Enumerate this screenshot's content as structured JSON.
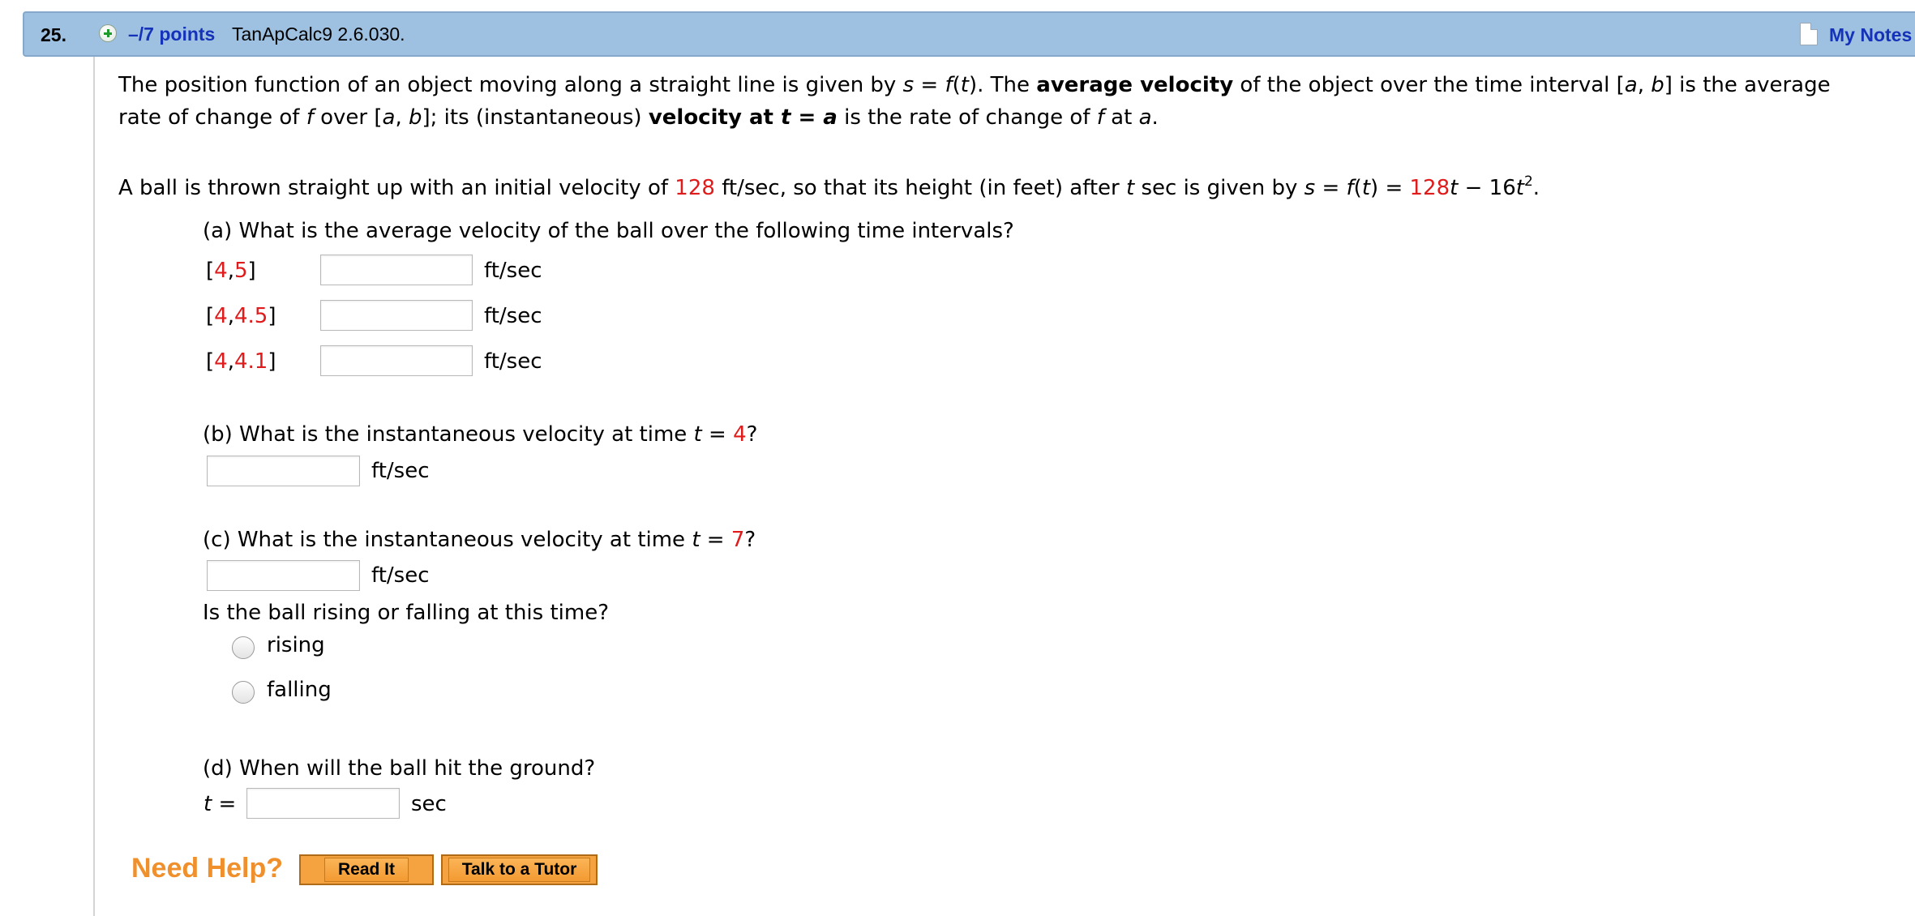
{
  "header": {
    "question_number": "25.",
    "points": "–/7 points",
    "source": "TanApCalc9 2.6.030.",
    "my_notes": "My Notes"
  },
  "intro": {
    "p1a": "The position function of an object moving along a straight line is given by ",
    "s": "s",
    "eq": " = ",
    "f": "f",
    "t": "t",
    "p1b": ". The ",
    "avg_vel": "average velocity",
    "p1c": " of the object over the time interval [",
    "a": "a",
    "comma": ", ",
    "b": "b",
    "p1d": "] is the average",
    "p2a": "rate of change of ",
    "p2b": " over [",
    "p2c": "]; its (instantaneous) ",
    "vel_at": "velocity at ",
    "p2d": " is the rate of change of ",
    "p2e": " at ",
    "period": "."
  },
  "problem": {
    "a1": "A ball is thrown straight up with an initial velocity of ",
    "v0": "128",
    "a2": " ft/sec, so that its height (in feet) after ",
    "a3": " sec is given by ",
    "coef": "128",
    "a4": " − 16",
    "exp": "2"
  },
  "part_a": {
    "question": "(a) What is the average velocity of the ball over the following time intervals?",
    "unit": "ft/sec",
    "intervals": [
      {
        "open": "[",
        "start": "4",
        "sep": ",",
        "end": "5",
        "close": "]"
      },
      {
        "open": "[",
        "start": "4",
        "sep": ",",
        "end": "4.5",
        "close": "]"
      },
      {
        "open": "[",
        "start": "4",
        "sep": ",",
        "end": "4.1",
        "close": "]"
      }
    ]
  },
  "part_b": {
    "q1": "(b) What is the instantaneous velocity at time ",
    "t": "t",
    "eq": " = ",
    "time": "4",
    "q2": "?",
    "unit": "ft/sec"
  },
  "part_c": {
    "q1": "(c) What is the instantaneous velocity at time ",
    "t": "t",
    "eq": " = ",
    "time": "7",
    "q2": "?",
    "unit": "ft/sec",
    "rising_question": "Is the ball rising or falling at this time?",
    "options": [
      "rising",
      "falling"
    ]
  },
  "part_d": {
    "question": "(d) When will the ball hit the ground?",
    "t_label": "t",
    "eq": " =",
    "unit": "sec"
  },
  "help": {
    "label": "Need Help?",
    "read_it": "Read It",
    "tutor": "Talk to a Tutor"
  },
  "colors": {
    "header_bg": "#9fc1e1",
    "link_blue": "#1533b8",
    "random_red": "#e01b1b",
    "help_orange": "#f0902c"
  }
}
